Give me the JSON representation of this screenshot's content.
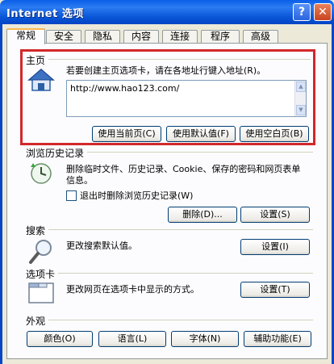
{
  "window": {
    "title": "Internet 选项",
    "help_glyph": "?",
    "close_glyph": "✕"
  },
  "tabs": [
    "常规",
    "安全",
    "隐私",
    "内容",
    "连接",
    "程序",
    "高级"
  ],
  "home": {
    "title": "主页",
    "instruction": "若要创建主页选项卡，请在各地址行键入地址(R)。",
    "url": "http://www.hao123.com/",
    "buttons": {
      "current": "使用当前页(C)",
      "default": "使用默认值(F)",
      "blank": "使用空白页(B)"
    }
  },
  "history": {
    "title": "浏览历史记录",
    "description": "删除临时文件、历史记录、Cookie、保存的密码和网页表单信息。",
    "exit_checkbox": "退出时删除浏览历史记录(W)",
    "buttons": {
      "delete": "删除(D)...",
      "settings": "设置(S)"
    }
  },
  "search": {
    "title": "搜索",
    "description": "更改搜索默认值。",
    "settings": "设置(I)"
  },
  "tabsection": {
    "title": "选项卡",
    "description": "更改网页在选项卡中显示的方式。",
    "settings": "设置(T)"
  },
  "appearance": {
    "title": "外观",
    "buttons": {
      "colors": "颜色(O)",
      "languages": "语言(L)",
      "fonts": "字体(N)",
      "accessibility": "辅助功能(E)"
    }
  },
  "colors": {
    "highlight": "#d2282a",
    "titlebar": "#0a5ee8"
  }
}
